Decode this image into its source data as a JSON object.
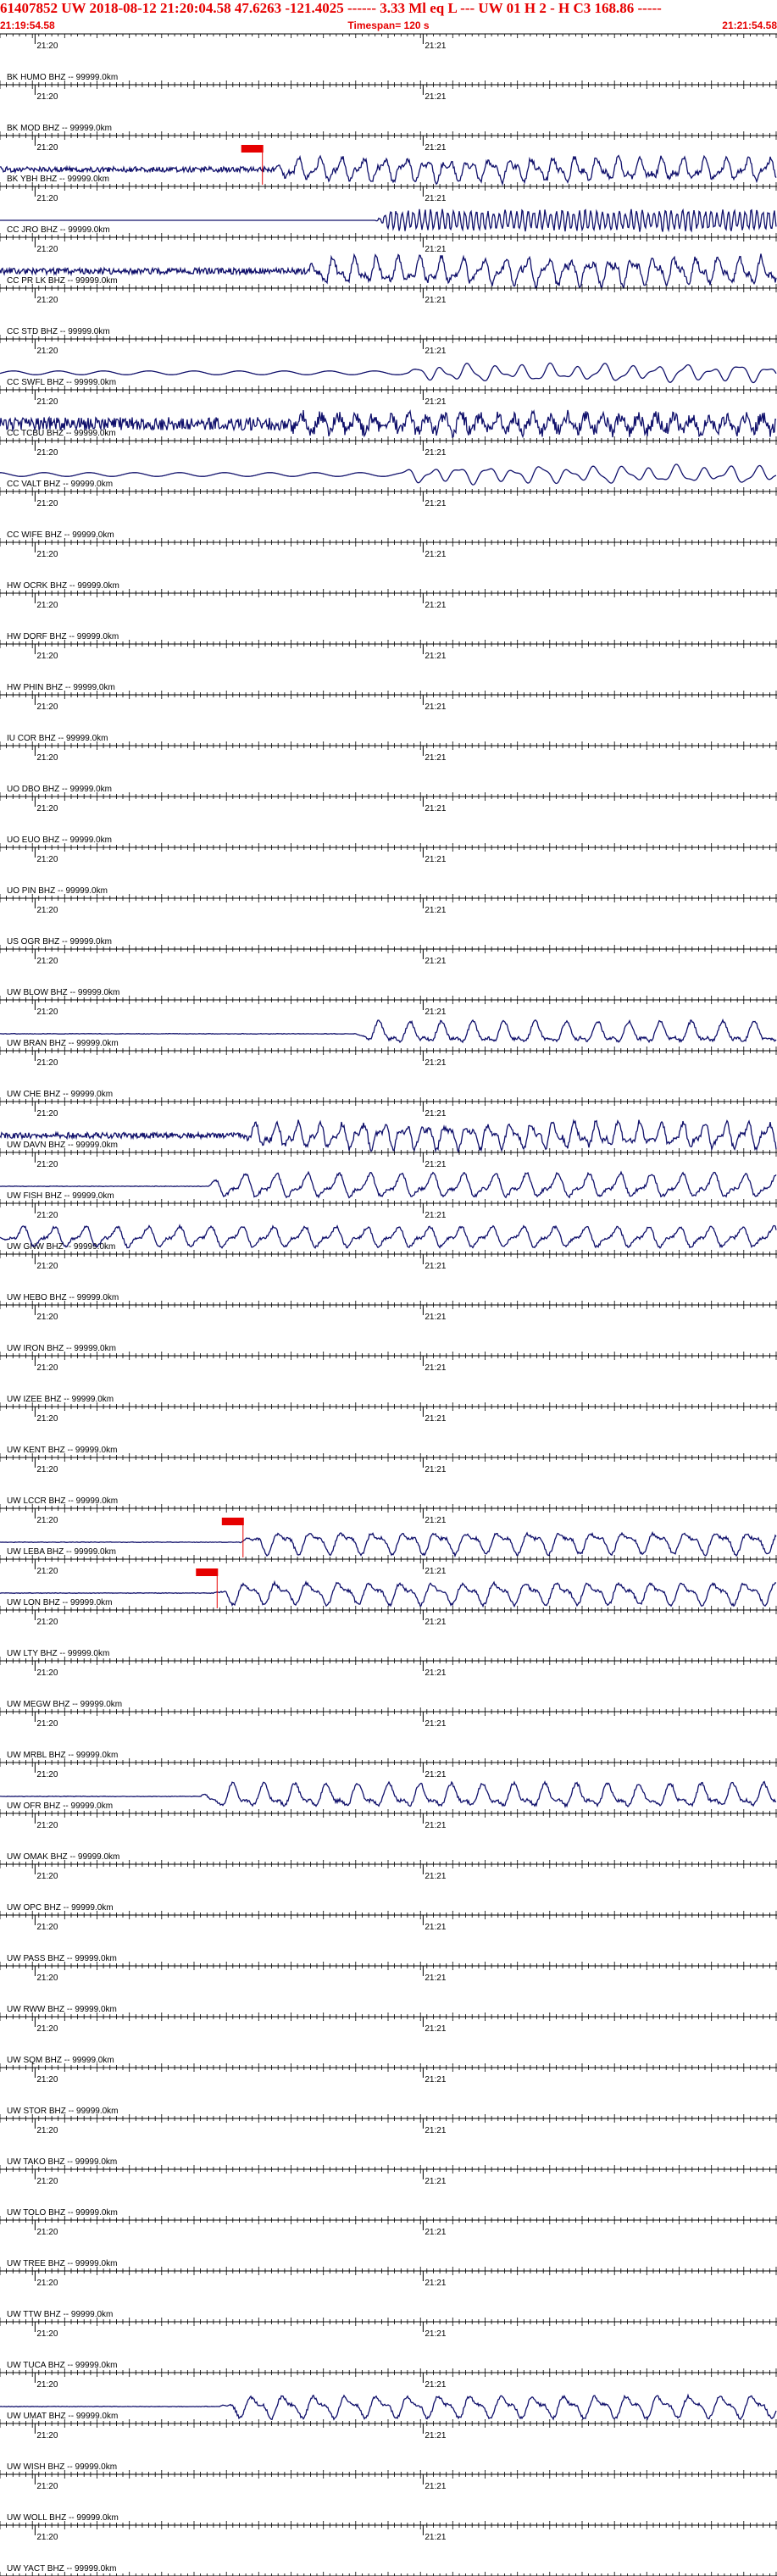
{
  "header": {
    "event": "61407852 UW 2018-08-12 21:20:04.58 47.6263 -121.4025 ------ 3.33 Ml eq L --- UW 01 H 2 - H C3 168.86 -----",
    "start_time": "21:19:54.58",
    "timespan": "Timespan= 120 s",
    "end_time": "21:21:54.58"
  },
  "colors": {
    "header": "#e60000",
    "trace": "#10106b",
    "grid": "#000000",
    "pick": "#e60000"
  },
  "chart_data": {
    "type": "line",
    "title": "",
    "x_range_seconds": [
      0,
      120
    ],
    "minute_labels": [
      "21:20",
      "21:21"
    ],
    "minute_marks_seconds": [
      5.42,
      65.42
    ],
    "channels": [
      {
        "label": "BK HUMO BHZ -- 99999.0km",
        "amp": 0,
        "onset": null,
        "cls": "none",
        "pick": null
      },
      {
        "label": "BK MOD BHZ -- 99999.0km",
        "amp": 0,
        "onset": null,
        "cls": "none",
        "pick": null
      },
      {
        "label": "BK YBH BHZ -- 99999.0km",
        "amp": 14,
        "onset": 42,
        "cls": "noisy",
        "pick": 39
      },
      {
        "label": "CC JRO BHZ -- 99999.0km",
        "amp": 13,
        "onset": 58,
        "cls": "hf",
        "pick": null
      },
      {
        "label": "CC PR LK BHZ -- 99999.0km",
        "amp": 16,
        "onset": 47,
        "cls": "noisy",
        "pick": null
      },
      {
        "label": "CC STD BHZ -- 99999.0km",
        "amp": 0,
        "onset": null,
        "cls": "none",
        "pick": null
      },
      {
        "label": "CC SWFL BHZ -- 99999.0km",
        "amp": 9,
        "onset": 63,
        "cls": "lowbg",
        "pick": null
      },
      {
        "label": "CC TCBU BHZ -- 99999.0km",
        "amp": 17,
        "onset": 44,
        "cls": "dense",
        "pick": null
      },
      {
        "label": "CC VALT BHZ -- 99999.0km",
        "amp": 9,
        "onset": 62,
        "cls": "lowbg",
        "pick": null
      },
      {
        "label": "CC WIFE BHZ -- 99999.0km",
        "amp": 0,
        "onset": null,
        "cls": "none",
        "pick": null
      },
      {
        "label": "HW OCRK BHZ -- 99999.0km",
        "amp": 0,
        "onset": null,
        "cls": "none",
        "pick": null
      },
      {
        "label": "HW DORF BHZ -- 99999.0km",
        "amp": 0,
        "onset": null,
        "cls": "none",
        "pick": null
      },
      {
        "label": "HW PHIN BHZ -- 99999.0km",
        "amp": 0,
        "onset": null,
        "cls": "none",
        "pick": null
      },
      {
        "label": "IU COR BHZ -- 99999.0km",
        "amp": 0,
        "onset": null,
        "cls": "none",
        "pick": null
      },
      {
        "label": "UO DBO BHZ -- 99999.0km",
        "amp": 0,
        "onset": null,
        "cls": "none",
        "pick": null
      },
      {
        "label": "UO EUO BHZ -- 99999.0km",
        "amp": 0,
        "onset": null,
        "cls": "none",
        "pick": null
      },
      {
        "label": "UO PIN BHZ -- 99999.0km",
        "amp": 0,
        "onset": null,
        "cls": "none",
        "pick": null
      },
      {
        "label": "US OGR BHZ -- 99999.0km",
        "amp": 0,
        "onset": null,
        "cls": "none",
        "pick": null
      },
      {
        "label": "UW BLOW BHZ -- 99999.0km",
        "amp": 0,
        "onset": null,
        "cls": "none",
        "pick": null
      },
      {
        "label": "UW BRAN BHZ -- 99999.0km",
        "amp": 14,
        "onset": 55,
        "cls": "wave",
        "pick": null
      },
      {
        "label": "UW CHE BHZ -- 99999.0km",
        "amp": 0,
        "onset": null,
        "cls": "none",
        "pick": null
      },
      {
        "label": "UW DAVN BHZ -- 99999.0km",
        "amp": 15,
        "onset": 37,
        "cls": "noisy",
        "pick": null
      },
      {
        "label": "UW FISH BHZ -- 99999.0km",
        "amp": 15,
        "onset": 32,
        "cls": "wave",
        "pick": null
      },
      {
        "label": "UW GNW BHZ -- 99999.0km",
        "amp": 13,
        "onset": 0,
        "cls": "wave",
        "pick": null
      },
      {
        "label": "UW HEBO BHZ -- 99999.0km",
        "amp": 0,
        "onset": null,
        "cls": "none",
        "pick": null
      },
      {
        "label": "UW IRON BHZ -- 99999.0km",
        "amp": 0,
        "onset": null,
        "cls": "none",
        "pick": null
      },
      {
        "label": "UW IZEE BHZ -- 99999.0km",
        "amp": 0,
        "onset": null,
        "cls": "none",
        "pick": null
      },
      {
        "label": "UW KENT BHZ -- 99999.0km",
        "amp": 0,
        "onset": null,
        "cls": "none",
        "pick": null
      },
      {
        "label": "UW LCCR BHZ -- 99999.0km",
        "amp": 0,
        "onset": null,
        "cls": "none",
        "pick": null
      },
      {
        "label": "UW LEBA BHZ -- 99999.0km",
        "amp": 14,
        "onset": 37,
        "cls": "wave",
        "pick": 36
      },
      {
        "label": "UW LON BHZ -- 99999.0km",
        "amp": 14,
        "onset": 33,
        "cls": "wave",
        "pick": 32
      },
      {
        "label": "UW LTY BHZ -- 99999.0km",
        "amp": 0,
        "onset": null,
        "cls": "none",
        "pick": null
      },
      {
        "label": "UW MEGW BHZ -- 99999.0km",
        "amp": 0,
        "onset": null,
        "cls": "none",
        "pick": null
      },
      {
        "label": "UW MRBL BHZ -- 99999.0km",
        "amp": 0,
        "onset": null,
        "cls": "none",
        "pick": null
      },
      {
        "label": "UW OFR BHZ -- 99999.0km",
        "amp": 15,
        "onset": 31,
        "cls": "wave",
        "pick": null
      },
      {
        "label": "UW OMAK BHZ -- 99999.0km",
        "amp": 0,
        "onset": null,
        "cls": "none",
        "pick": null
      },
      {
        "label": "UW OPC BHZ -- 99999.0km",
        "amp": 0,
        "onset": null,
        "cls": "none",
        "pick": null
      },
      {
        "label": "UW PASS BHZ -- 99999.0km",
        "amp": 0,
        "onset": null,
        "cls": "none",
        "pick": null
      },
      {
        "label": "UW RWW BHZ -- 99999.0km",
        "amp": 0,
        "onset": null,
        "cls": "none",
        "pick": null
      },
      {
        "label": "UW SQM BHZ -- 99999.0km",
        "amp": 0,
        "onset": null,
        "cls": "none",
        "pick": null
      },
      {
        "label": "UW STOR BHZ -- 99999.0km",
        "amp": 0,
        "onset": null,
        "cls": "none",
        "pick": null
      },
      {
        "label": "UW TAKO BHZ -- 99999.0km",
        "amp": 0,
        "onset": null,
        "cls": "none",
        "pick": null
      },
      {
        "label": "UW TOLO BHZ -- 99999.0km",
        "amp": 0,
        "onset": null,
        "cls": "none",
        "pick": null
      },
      {
        "label": "UW TREE BHZ -- 99999.0km",
        "amp": 0,
        "onset": null,
        "cls": "none",
        "pick": null
      },
      {
        "label": "UW TTW BHZ -- 99999.0km",
        "amp": 0,
        "onset": null,
        "cls": "none",
        "pick": null
      },
      {
        "label": "UW TUCA BHZ -- 99999.0km",
        "amp": 0,
        "onset": null,
        "cls": "none",
        "pick": null
      },
      {
        "label": "UW UMAT BHZ -- 99999.0km",
        "amp": 14,
        "onset": 34,
        "cls": "wave",
        "pick": null
      },
      {
        "label": "UW WISH BHZ -- 99999.0km",
        "amp": 0,
        "onset": null,
        "cls": "none",
        "pick": null
      },
      {
        "label": "UW WOLL BHZ -- 99999.0km",
        "amp": 0,
        "onset": null,
        "cls": "none",
        "pick": null
      },
      {
        "label": "UW YACT BHZ -- 99999.0km",
        "amp": 0,
        "onset": null,
        "cls": "none",
        "pick": null
      }
    ]
  }
}
